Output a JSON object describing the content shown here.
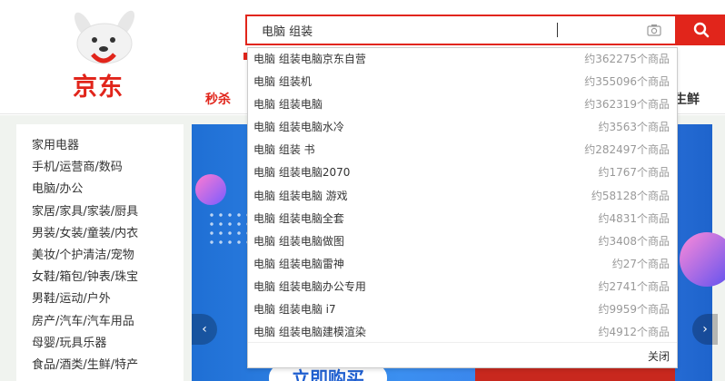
{
  "header": {
    "logo_text": "京东",
    "search": {
      "value": "电脑 组装"
    },
    "nav": {
      "seckill": "秒杀",
      "fresh": "生鲜"
    }
  },
  "categories": [
    "家用电器",
    "手机/运营商/数码",
    "电脑/办公",
    "家居/家具/家装/厨具",
    "男装/女装/童装/内衣",
    "美妆/个护清洁/宠物",
    "女鞋/箱包/钟表/珠宝",
    "男鞋/运动/户外",
    "房产/汽车/汽车用品",
    "母婴/玩具乐器",
    "食品/酒类/生鲜/特产"
  ],
  "suggestions": [
    {
      "term": "电脑 组装电脑京东自营",
      "count": "约362275个商品"
    },
    {
      "term": "电脑 组装机",
      "count": "约355096个商品"
    },
    {
      "term": "电脑 组装电脑",
      "count": "约362319个商品"
    },
    {
      "term": "电脑 组装电脑水冷",
      "count": "约3563个商品"
    },
    {
      "term": "电脑 组装 书",
      "count": "约282497个商品"
    },
    {
      "term": "电脑 组装电脑2070",
      "count": "约1767个商品"
    },
    {
      "term": "电脑 组装电脑 游戏",
      "count": "约58128个商品"
    },
    {
      "term": "电脑 组装电脑全套",
      "count": "约4831个商品"
    },
    {
      "term": "电脑 组装电脑做图",
      "count": "约3408个商品"
    },
    {
      "term": "电脑 组装电脑雷神",
      "count": "约27个商品"
    },
    {
      "term": "电脑 组装电脑办公专用",
      "count": "约2741个商品"
    },
    {
      "term": "电脑 组装电脑 i7",
      "count": "约9959个商品"
    },
    {
      "term": "电脑 组装电脑建模渲染",
      "count": "约4912个商品"
    }
  ],
  "dropdown": {
    "close_label": "关闭"
  },
  "banner": {
    "cta": "立即购买",
    "prev_arrow": "‹",
    "next_arrow": "›"
  },
  "colors": {
    "brand_red": "#e1251b",
    "banner_blue": "#3a7fe9"
  }
}
